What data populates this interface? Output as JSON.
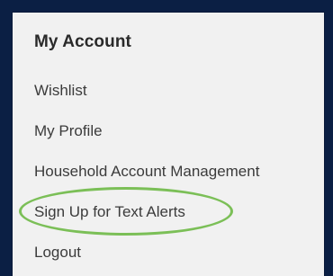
{
  "account_menu": {
    "title": "My Account",
    "items": [
      {
        "label": "Wishlist"
      },
      {
        "label": "My Profile"
      },
      {
        "label": "Household Account Management"
      },
      {
        "label": "Sign Up for Text Alerts"
      },
      {
        "label": "Logout"
      }
    ]
  },
  "colors": {
    "background": "#0b1f44",
    "panel": "#f1f1f1",
    "text": "#3b3b3b",
    "highlight_ring": "#7bbf57"
  }
}
